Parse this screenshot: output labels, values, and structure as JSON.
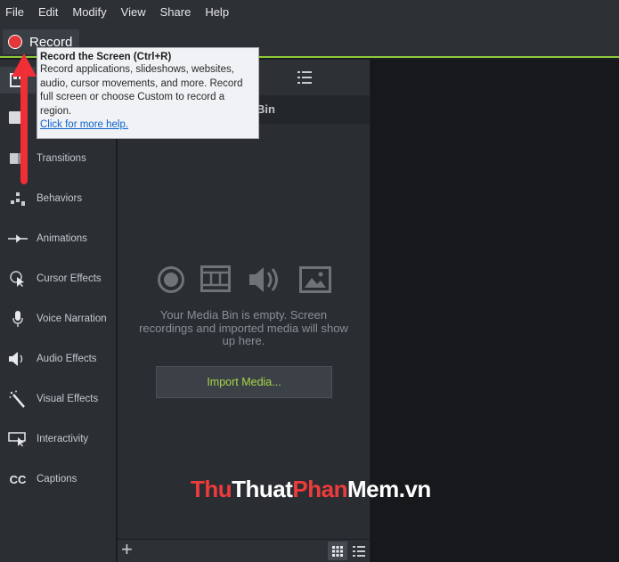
{
  "menu": [
    "File",
    "Edit",
    "Modify",
    "View",
    "Share",
    "Help"
  ],
  "record": {
    "label": "Record",
    "color": "#e3373a"
  },
  "accent": "#8fc93a",
  "sidebar": {
    "items": [
      {
        "label": "Transitions",
        "icon": "transitions-icon"
      },
      {
        "label": "Behaviors",
        "icon": "behaviors-icon"
      },
      {
        "label": "Animations",
        "icon": "animations-icon"
      },
      {
        "label": "Cursor Effects",
        "icon": "cursor-effects-icon"
      },
      {
        "label": "Voice Narration",
        "icon": "microphone-icon"
      },
      {
        "label": "Audio Effects",
        "icon": "speaker-icon"
      },
      {
        "label": "Visual Effects",
        "icon": "magic-wand-icon"
      },
      {
        "label": "Interactivity",
        "icon": "interactivity-icon"
      },
      {
        "label": "Captions",
        "icon": "captions-icon"
      }
    ],
    "captions_glyph": "CC"
  },
  "bin": {
    "title_partial": "Bin",
    "empty_message": "Your Media Bin is empty. Screen recordings and imported media will show up here.",
    "import_label": "Import Media...",
    "import_color": "#a6d64a",
    "add_glyph": "+"
  },
  "tooltip": {
    "title": "Record the Screen (Ctrl+R)",
    "body": "Record applications, slideshows, websites, audio, cursor movements, and more. Record full screen or choose Custom to record a region.",
    "link": "Click for more help."
  },
  "watermark": {
    "part1": "Thu",
    "part2": "Thuat",
    "part3": "Phan",
    "part4": "Mem",
    "part5": ".vn"
  }
}
